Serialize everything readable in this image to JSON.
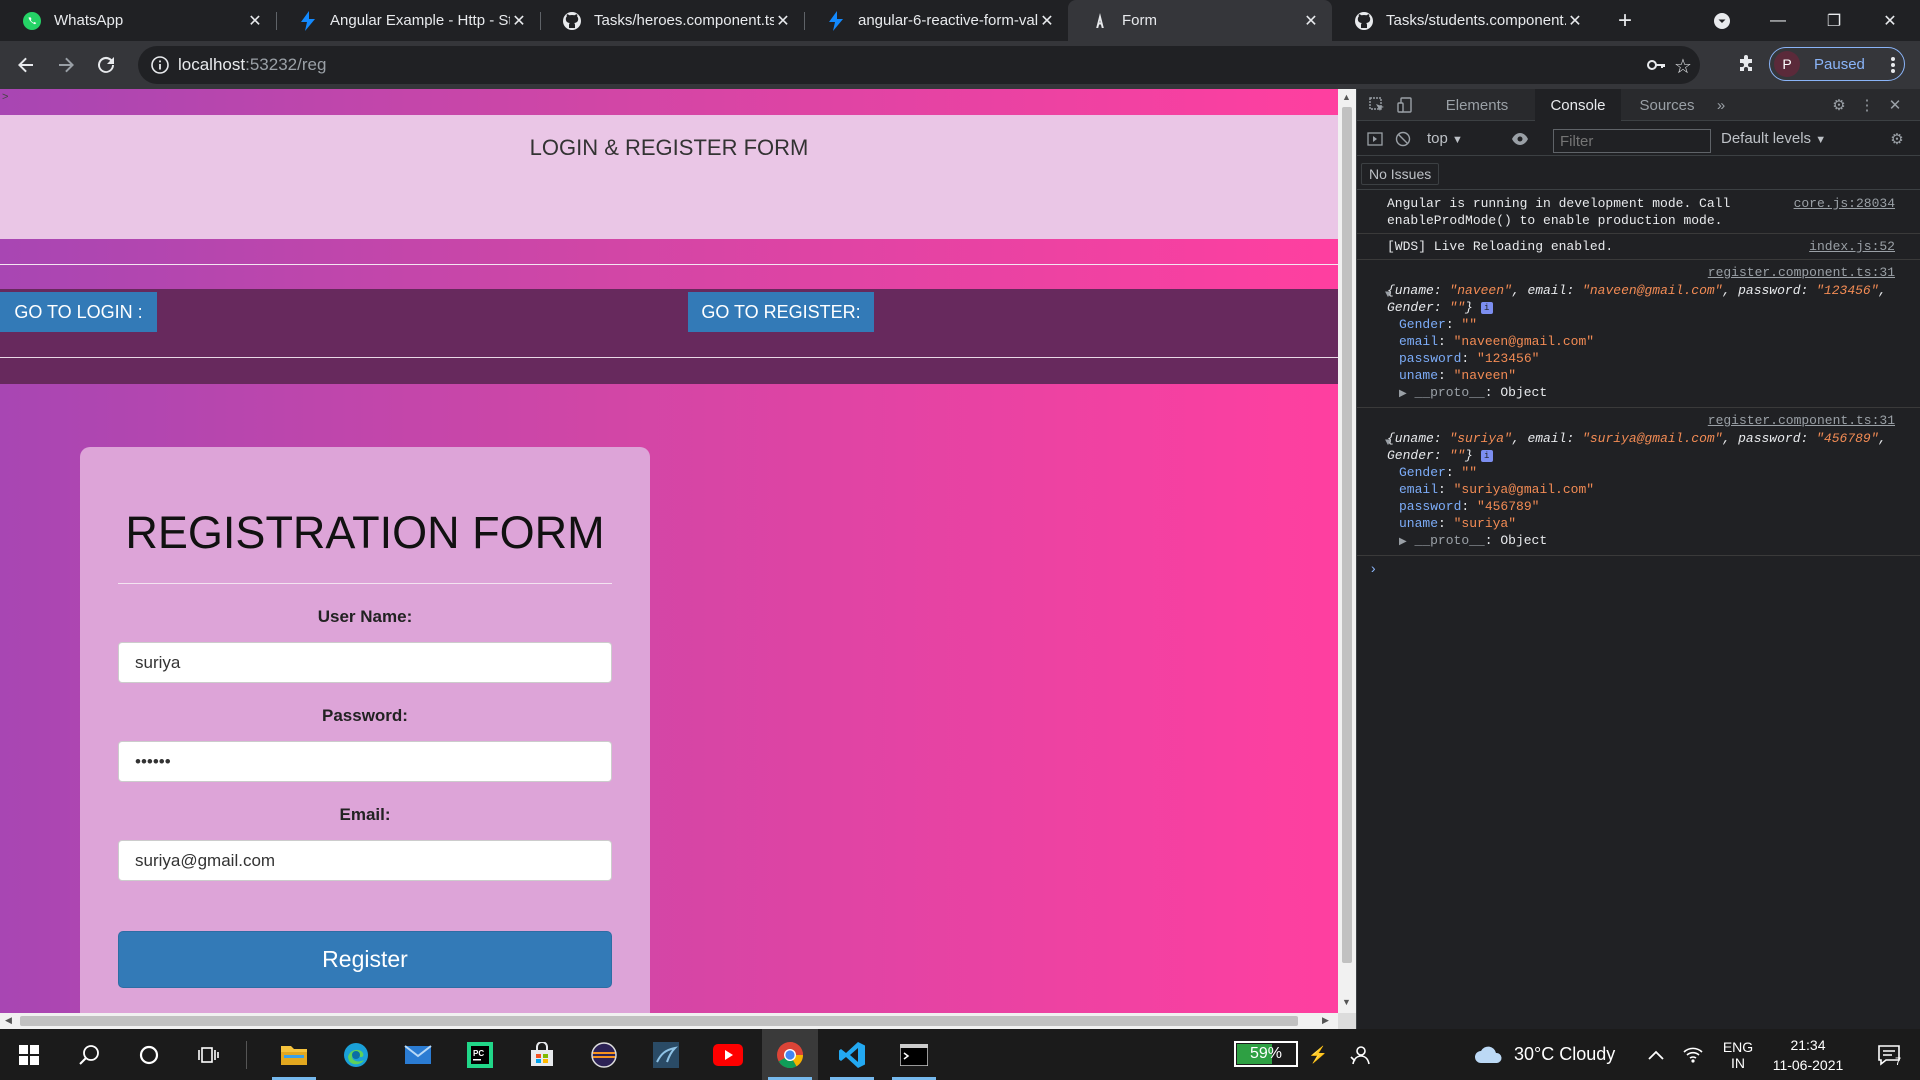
{
  "browser": {
    "tabs": [
      {
        "title": "WhatsApp",
        "icon": "whatsapp-icon"
      },
      {
        "title": "Angular Example - Http - St",
        "icon": "stackblitz-icon"
      },
      {
        "title": "Tasks/heroes.component.ts",
        "icon": "github-icon"
      },
      {
        "title": "angular-6-reactive-form-val",
        "icon": "stackblitz-icon"
      },
      {
        "title": "Form",
        "icon": "angular-icon",
        "active": true
      },
      {
        "title": "Tasks/students.component.",
        "icon": "github-icon"
      }
    ],
    "url_host": "localhost",
    "url_rest": ":53232/reg",
    "profile_initial": "P",
    "profile_status": "Paused"
  },
  "page": {
    "app_caret": ">",
    "header_title": "LOGIN & REGISTER FORM",
    "nav": {
      "login": "GO TO LOGIN :",
      "register": "GO TO REGISTER:"
    },
    "form": {
      "title": "REGISTRATION FORM",
      "username_label": "User Name:",
      "username_value": "suriya",
      "password_label": "Password:",
      "password_value": "456789",
      "email_label": "Email:",
      "email_value": "suriya@gmail.com",
      "submit": "Register"
    }
  },
  "devtools": {
    "tabs": [
      "Elements",
      "Console",
      "Sources"
    ],
    "active_tab": "Console",
    "context": "top",
    "filter_placeholder": "Filter",
    "levels": "Default levels",
    "issues": "No Issues",
    "messages": [
      {
        "text": "Angular is running in development mode. Call enableProdMode() to enable production mode.",
        "source": "core.js:28034"
      },
      {
        "text": "[WDS] Live Reloading enabled.",
        "source": "index.js:52"
      }
    ],
    "logs": [
      {
        "source": "register.component.ts:31",
        "head_a": "{uname: ",
        "uname": "\"naveen\"",
        "head_b": ", email: ",
        "email": "\"naveen@gmail.com\"",
        "head_c": ", password: ",
        "password": "\"123456\"",
        "head_d": ", Gender: ",
        "gender": "\"\"",
        "head_e": "}",
        "props": [
          {
            "k": "Gender",
            "v": "\"\""
          },
          {
            "k": "email",
            "v": "\"naveen@gmail.com\""
          },
          {
            "k": "password",
            "v": "\"123456\""
          },
          {
            "k": "uname",
            "v": "\"naveen\""
          }
        ],
        "proto": "__proto__",
        "proto_val": "Object"
      },
      {
        "source": "register.component.ts:31",
        "head_a": "{uname: ",
        "uname": "\"suriya\"",
        "head_b": ", email: ",
        "email": "\"suriya@gmail.com\"",
        "head_c": ", password: ",
        "password": "\"456789\"",
        "head_d": ", Gender: ",
        "gender": "\"\"",
        "head_e": "}",
        "props": [
          {
            "k": "Gender",
            "v": "\"\""
          },
          {
            "k": "email",
            "v": "\"suriya@gmail.com\""
          },
          {
            "k": "password",
            "v": "\"456789\""
          },
          {
            "k": "uname",
            "v": "\"suriya\""
          }
        ],
        "proto": "__proto__",
        "proto_val": "Object"
      }
    ],
    "prompt": "›"
  },
  "taskbar": {
    "battery": "59%",
    "weather": "30°C  Cloudy",
    "lang_top": "ENG",
    "lang_bottom": "IN",
    "time": "21:34",
    "date": "11-06-2021",
    "notifications": "7"
  },
  "colors": {
    "chrome_bg": "#202124",
    "toolbar_bg": "#35363a",
    "bootstrap_primary": "#337ab7",
    "hero_bg": "#eac6e6",
    "nav_bg": "#67295d",
    "card_bg": "#dda4d8"
  }
}
